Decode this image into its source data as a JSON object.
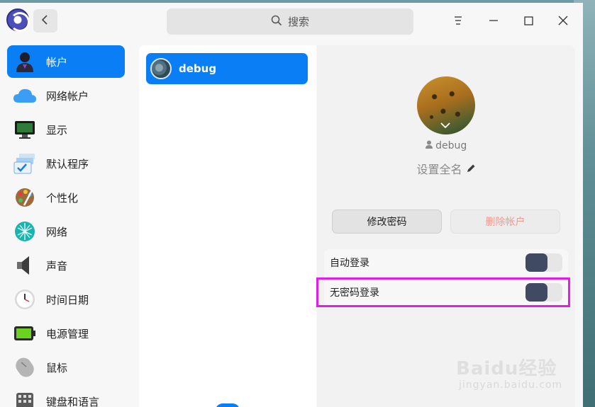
{
  "titlebar": {
    "search_placeholder": "搜索",
    "icons": [
      "app-logo",
      "back-arrow-icon",
      "search-icon",
      "menu-icon",
      "minimize-icon",
      "maximize-icon",
      "close-icon"
    ]
  },
  "sidebar": {
    "items": [
      {
        "label": "帐户",
        "icon": "account-icon",
        "active": true
      },
      {
        "label": "网络帐户",
        "icon": "cloud-icon",
        "active": false
      },
      {
        "label": "显示",
        "icon": "display-icon",
        "active": false
      },
      {
        "label": "默认程序",
        "icon": "default-apps-icon",
        "active": false
      },
      {
        "label": "个性化",
        "icon": "palette-icon",
        "active": false
      },
      {
        "label": "网络",
        "icon": "network-icon",
        "active": false
      },
      {
        "label": "声音",
        "icon": "speaker-icon",
        "active": false
      },
      {
        "label": "时间日期",
        "icon": "clock-icon",
        "active": false
      },
      {
        "label": "电源管理",
        "icon": "battery-icon",
        "active": false
      },
      {
        "label": "鼠标",
        "icon": "mouse-icon",
        "active": false
      },
      {
        "label": "键盘和语言",
        "icon": "keyboard-icon",
        "active": false
      }
    ]
  },
  "users": {
    "list": [
      {
        "name": "debug",
        "selected": true
      }
    ]
  },
  "detail": {
    "username": "debug",
    "fullname_prompt": "设置全名",
    "change_password": "修改密码",
    "delete_account": "删除帐户",
    "auto_login_label": "自动登录",
    "passwordless_login_label": "无密码登录"
  },
  "watermark": {
    "brand": "Baidu经验",
    "url": "jingyan.baidu.com"
  },
  "colors": {
    "accent": "#0a7ff5",
    "toggle_knob": "#414a63",
    "delete_text": "#f09a8f",
    "highlight": "#e21ee6"
  }
}
